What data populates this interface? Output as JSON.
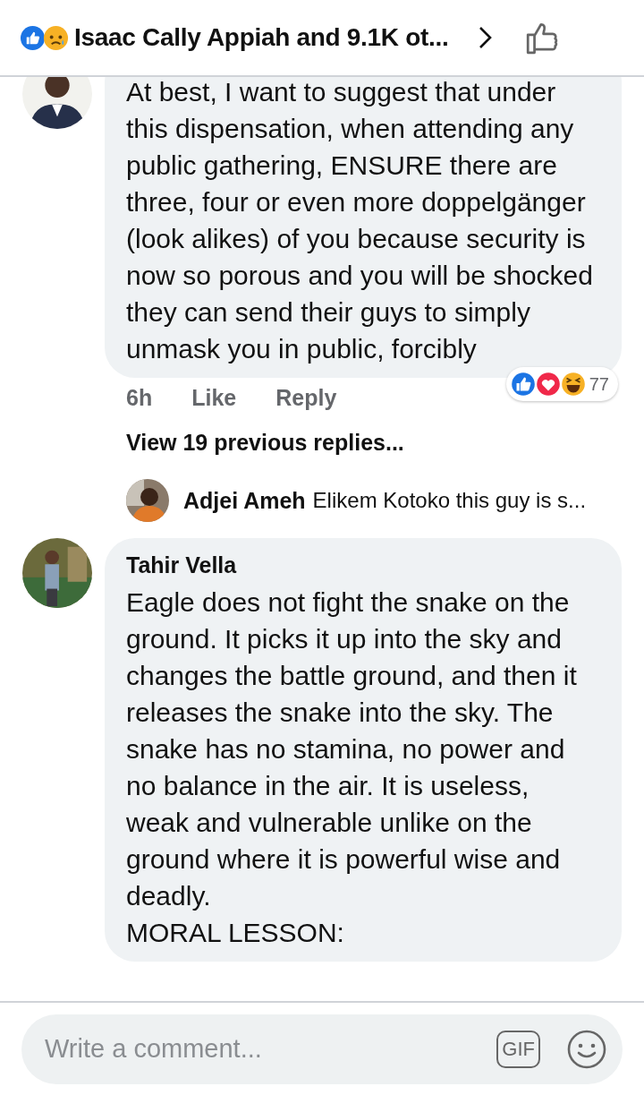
{
  "header": {
    "title": "Isaac Cally Appiah and 9.1K ot..."
  },
  "comments": [
    {
      "text": "At best, I want to suggest that under this dispensation, when attending any public gathering, ENSURE there are three, four or even more doppelgänger (look alikes) of you because security is now so porous and you will be shocked they can send their guys to simply unmask you in public, forcibly",
      "time": "6h",
      "like": "Like",
      "reply": "Reply",
      "reaction_count": "77",
      "view_replies": "View 19 previous replies...",
      "reply_preview": {
        "author": "Adjei Ameh",
        "text": "Elikem Kotoko this guy is s..."
      }
    },
    {
      "author": "Tahir Vella",
      "text": "Eagle does not fight the snake on the ground. It picks it up into the sky and changes the battle ground, and then it releases the snake into the sky. The snake has no stamina, no power and no balance in the air. It is useless, weak and vulnerable unlike on the ground where it is powerful wise and deadly.\nMORAL LESSON:"
    }
  ],
  "composer": {
    "placeholder": "Write a comment...",
    "gif_label": "GIF"
  }
}
